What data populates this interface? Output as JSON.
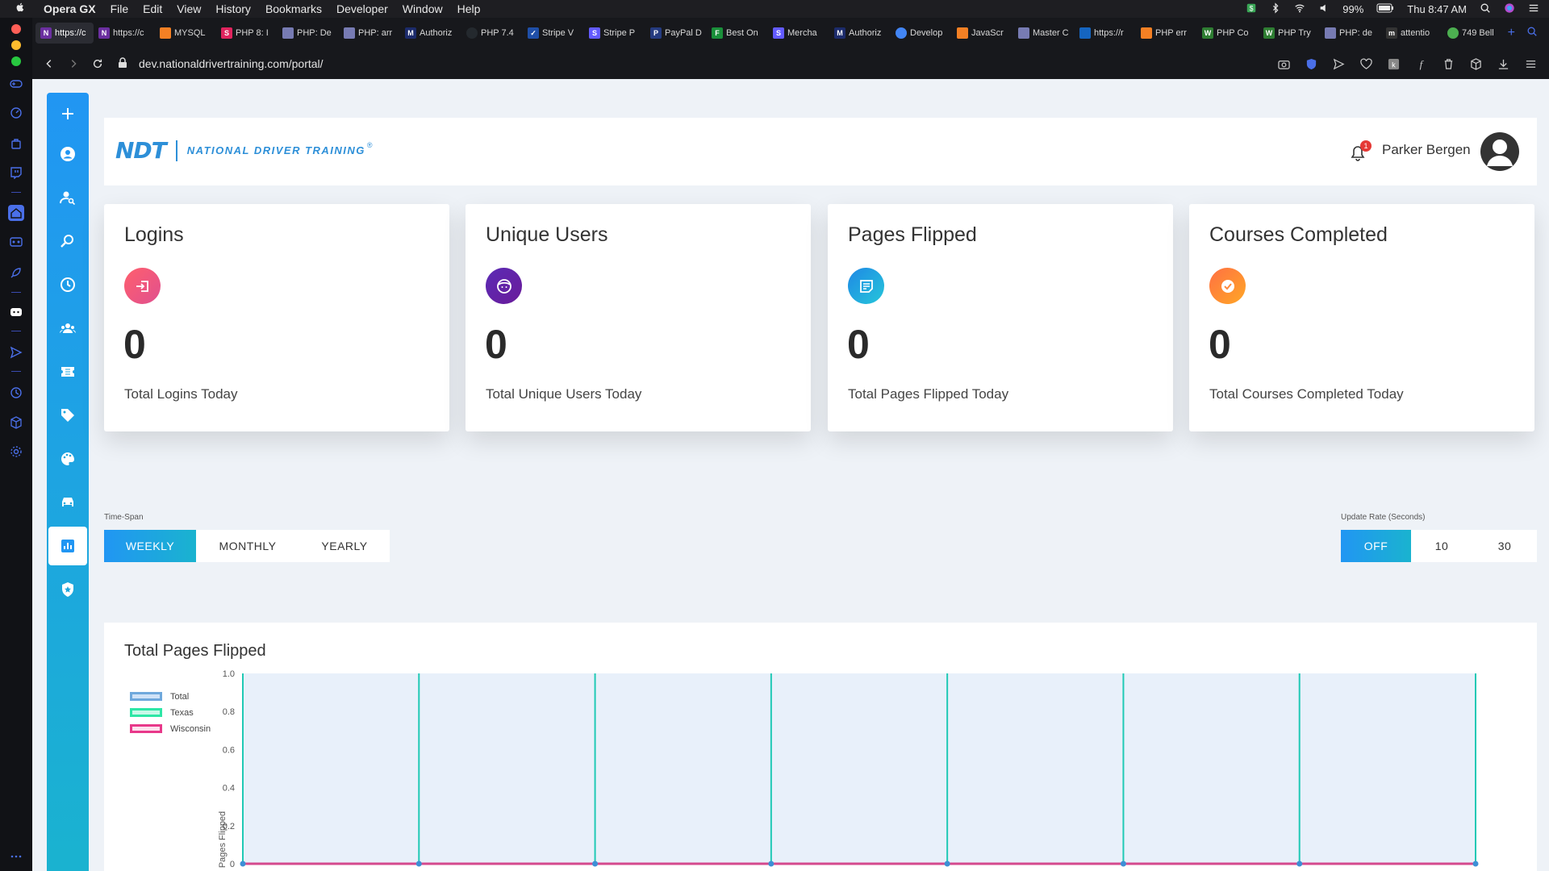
{
  "menubar": {
    "app_name": "Opera GX",
    "items": [
      "File",
      "Edit",
      "View",
      "History",
      "Bookmarks",
      "Developer",
      "Window",
      "Help"
    ],
    "battery": "99%",
    "clock": "Thu 8:47 AM"
  },
  "tabs": [
    {
      "label": "https://c",
      "color": "#6b2fa0"
    },
    {
      "label": "https://c",
      "color": "#6b2fa0"
    },
    {
      "label": "MYSQL",
      "color": "#f48024"
    },
    {
      "label": "PHP 8: I",
      "color": "#e0245e"
    },
    {
      "label": "PHP: De",
      "color": "#777bb3"
    },
    {
      "label": "PHP: arr",
      "color": "#777bb3"
    },
    {
      "label": "Authoriz",
      "color": "#1c2b6b"
    },
    {
      "label": "PHP 7.4",
      "color": "#24292e"
    },
    {
      "label": "Stripe V",
      "color": "#1f4fa8"
    },
    {
      "label": "Stripe P",
      "color": "#635bff"
    },
    {
      "label": "PayPal D",
      "color": "#253b80"
    },
    {
      "label": "Best On",
      "color": "#1a8f3a"
    },
    {
      "label": "Mercha",
      "color": "#635bff"
    },
    {
      "label": "Authoriz",
      "color": "#1c2b6b"
    },
    {
      "label": "Develop",
      "color": "#4285f4"
    },
    {
      "label": "JavaScr",
      "color": "#f48024"
    },
    {
      "label": "Master C",
      "color": "#777bb3"
    },
    {
      "label": "https://r",
      "color": "#1565c0"
    },
    {
      "label": "PHP err",
      "color": "#f48024"
    },
    {
      "label": "PHP Co",
      "color": "#2e7d32"
    },
    {
      "label": "PHP Try",
      "color": "#2e7d32"
    },
    {
      "label": "PHP: de",
      "color": "#777bb3"
    },
    {
      "label": "attentio",
      "color": "#333333"
    },
    {
      "label": "749 Bell",
      "color": "#4caf50"
    }
  ],
  "address": {
    "url": "dev.nationaldrivertraining.com/portal/"
  },
  "header": {
    "logo_short": "NDT",
    "logo_full": "NATIONAL DRIVER TRAINING",
    "logo_reg": "®",
    "notification_count": "1",
    "user_name": "Parker Bergen"
  },
  "stats": [
    {
      "title": "Logins",
      "value": "0",
      "desc": "Total Logins Today",
      "icon": "login-icon",
      "gradient": [
        "#ff5f6d",
        "#e0508f"
      ]
    },
    {
      "title": "Unique Users",
      "value": "0",
      "desc": "Total Unique Users Today",
      "icon": "face-icon",
      "gradient": [
        "#5b2bb5",
        "#6a1b9a"
      ]
    },
    {
      "title": "Pages Flipped",
      "value": "0",
      "desc": "Total Pages Flipped Today",
      "icon": "note-icon",
      "gradient": [
        "#1e88e5",
        "#26c6da"
      ]
    },
    {
      "title": "Courses Completed",
      "value": "0",
      "desc": "Total Courses Completed Today",
      "icon": "check-circle-icon",
      "gradient": [
        "#ff7043",
        "#ffa726"
      ]
    }
  ],
  "controls": {
    "timespan_label": "Time-Span",
    "timespan_options": [
      "WEEKLY",
      "MONTHLY",
      "YEARLY"
    ],
    "timespan_selected": "WEEKLY",
    "update_label": "Update Rate (Seconds)",
    "update_options": [
      "OFF",
      "10",
      "30"
    ],
    "update_selected": "OFF"
  },
  "chart": {
    "title": "Total Pages Flipped",
    "ylabel": "Pages Flipped",
    "legend": [
      {
        "name": "Total",
        "color": "#6fa8dc"
      },
      {
        "name": "Texas",
        "color": "#2ee6a6"
      },
      {
        "name": "Wisconsin",
        "color": "#e8388a"
      }
    ]
  },
  "chart_data": {
    "type": "line",
    "title": "Total Pages Flipped",
    "ylabel": "Pages Flipped",
    "ylim": [
      0,
      1.0
    ],
    "yticks": [
      "1.0",
      "0.8",
      "0.6",
      "0.4",
      "0.2",
      "0"
    ],
    "series": [
      {
        "name": "Total",
        "values": [
          0,
          0,
          0,
          0,
          0,
          0,
          0,
          0
        ]
      },
      {
        "name": "Texas",
        "values": [
          0,
          0,
          0,
          0,
          0,
          0,
          0,
          0
        ]
      },
      {
        "name": "Wisconsin",
        "values": [
          0,
          0,
          0,
          0,
          0,
          0,
          0,
          0
        ]
      }
    ]
  }
}
